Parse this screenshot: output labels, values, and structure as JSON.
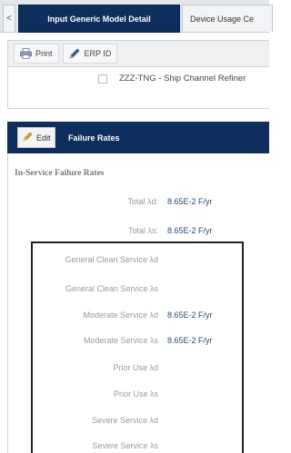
{
  "tabs": {
    "back_label": "<",
    "active_label": "Input Generic Model Detail",
    "inactive_label": "Device Usage Ce"
  },
  "toolbar": {
    "print_label": "Print",
    "erp_label": "ERP ID"
  },
  "list": {
    "item_text": "ZZZ-TNG - Ship Channel Refiner"
  },
  "panel": {
    "edit_label": "Edit",
    "title": "Failure Rates",
    "section_title": "In-Service Failure Rates",
    "rows": [
      {
        "label": "Total λd:",
        "value": "8.65E-2 F/yr"
      },
      {
        "label": "Total λs:",
        "value": "8.65E-2 F/yr"
      },
      {
        "label": "General Clean Service λd",
        "value": ""
      },
      {
        "label": "General Clean Service λs",
        "value": ""
      },
      {
        "label": "Moderate Service λd",
        "value": "8.65E-2 F/yr"
      },
      {
        "label": "Moderate Service λs",
        "value": "8.65E-2 F/yr"
      },
      {
        "label": "Prior Use λd",
        "value": ""
      },
      {
        "label": "Prior Use λs",
        "value": ""
      },
      {
        "label": "Severe Service λd",
        "value": ""
      },
      {
        "label": "Severe Service λs",
        "value": ""
      }
    ]
  },
  "colors": {
    "header_navy": "#0e2f5e",
    "value_blue": "#2a4a7a",
    "label_gray": "#9a9a9a"
  }
}
